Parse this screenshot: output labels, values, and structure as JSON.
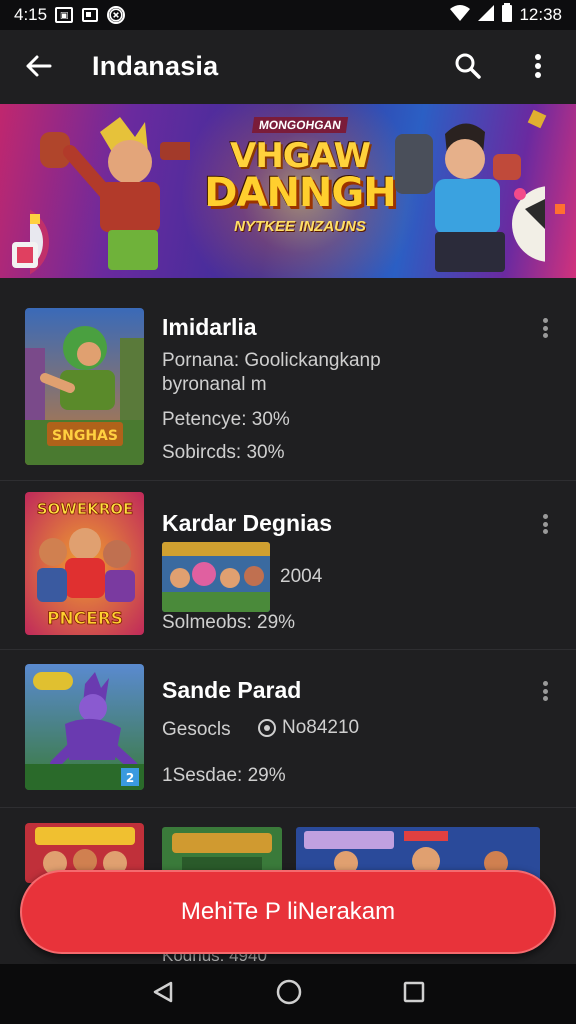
{
  "status_bar": {
    "time": "4:15",
    "battery_time": "12:38"
  },
  "app_bar": {
    "title": "Indanasia"
  },
  "hero": {
    "top_text": "MONGOHGAN",
    "title_line1": "VHGAW",
    "title_line2": "DANNGH",
    "subtitle": "NYTKEE INZAUNS"
  },
  "items": [
    {
      "title": "Imidarlia",
      "line1": "Pornana: Goolickangkanp",
      "line2": "byronanal m",
      "line3": "Petencye: 30%",
      "line4": "Sobircds: 30%"
    },
    {
      "title": "Kardar Degnias",
      "thumb_text_top": "SOWEKROE",
      "thumb_text_bottom": "PNCERS",
      "inline_value": "2004",
      "line_bottom": "Solmeobs: 29%"
    },
    {
      "title": "Sande Parad",
      "line1_label": "Gesocls",
      "line1_value": "No84210",
      "line_bottom": "1Sesdae: 29%"
    }
  ],
  "partial_row": {
    "bottom_text": "Kodnus: 4940"
  },
  "cta": {
    "label": "MehiTe P liNerakam"
  },
  "colors": {
    "accent": "#e8333a",
    "background": "#1f1f21"
  }
}
